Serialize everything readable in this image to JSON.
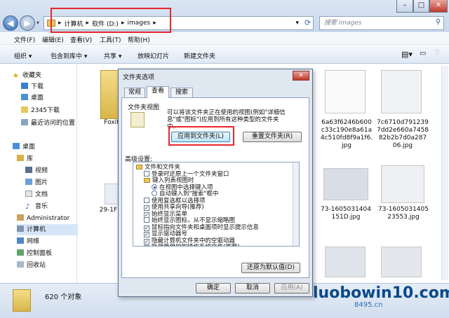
{
  "address": {
    "crumbs": [
      "计算机",
      "软件 (D:)",
      "images"
    ],
    "refresh_icon": "refresh-icon"
  },
  "search": {
    "placeholder": "搜索 images"
  },
  "menu": [
    "文件(F)",
    "编辑(E)",
    "查看(V)",
    "工具(T)",
    "帮助(H)"
  ],
  "toolbar": [
    "组织 ▾",
    "包含到库中 ▾",
    "共享 ▾",
    "放映幻灯片",
    "新建文件夹"
  ],
  "nav": {
    "favorites": {
      "label": "收藏夹",
      "items": [
        "下载",
        "桌面",
        "2345下载",
        "最近访问的位置"
      ]
    },
    "desktop": {
      "label": "桌面",
      "library": "库",
      "lib_items": [
        "视频",
        "图片",
        "文档",
        "音乐"
      ]
    },
    "others": [
      "Administrator",
      "计算机",
      "网络",
      "控制面板",
      "回收站"
    ]
  },
  "files": {
    "foxit": "Foxit",
    "file_29": "29-1FF",
    "f1": [
      "6a63f6246b600",
      "c33c190e8a61a",
      "4c510fd8f9a1f6.",
      "jpg"
    ],
    "f2": [
      "7c6710d791239",
      "7dd2e660a7458",
      "82b2b7d0a287",
      "06.jpg"
    ],
    "f3": [
      "73-1605031404",
      "151D.jpg"
    ],
    "f4": [
      "73-1605031405",
      "23553.jpg"
    ]
  },
  "status": {
    "count": "620 个对象"
  },
  "dialog": {
    "title": "文件夹选项",
    "close": "✕",
    "tabs": [
      "常规",
      "查看",
      "搜索"
    ],
    "folder_view_heading": "文件夹视图",
    "folder_view_desc": [
      "可以将该文件夹正在使用的视图(例如\"详细信",
      "息\"或\"图标\")应用到所有这种类型的文件夹",
      "中。"
    ],
    "apply_btn": "应用到文件夹(L)",
    "reset_btn": "重置文件夹(R)",
    "advanced_label": "高级设置:",
    "tree": [
      {
        "type": "folder",
        "text": "文件和文件夹",
        "indent": 0
      },
      {
        "type": "cb",
        "checked": false,
        "text": "登录时还原上一个文件夹窗口",
        "indent": 1
      },
      {
        "type": "folder",
        "text": "键入列表视图时",
        "indent": 1
      },
      {
        "type": "rb",
        "checked": true,
        "text": "在视图中选择键入项",
        "indent": 2
      },
      {
        "type": "rb",
        "checked": false,
        "text": "自动键入到\"搜索\"框中",
        "indent": 2
      },
      {
        "type": "cb",
        "checked": false,
        "text": "使用复选框以选择项",
        "indent": 1
      },
      {
        "type": "cb",
        "checked": true,
        "text": "使用共享向导(推荐)",
        "indent": 1
      },
      {
        "type": "cb",
        "checked": true,
        "text": "始终显示菜单",
        "indent": 1
      },
      {
        "type": "cb",
        "checked": false,
        "text": "始终显示图标，从不显示缩略图",
        "indent": 1
      },
      {
        "type": "cb",
        "checked": true,
        "text": "鼠标指向文件夹和桌面项时显示提示信息",
        "indent": 1
      },
      {
        "type": "cb",
        "checked": true,
        "text": "显示驱动器号",
        "indent": 1
      },
      {
        "type": "cb",
        "checked": true,
        "text": "隐藏计算机文件夹中的空驱动器",
        "indent": 1
      },
      {
        "type": "cb",
        "checked": true,
        "text": "隐藏受保护的操作系统文件(推荐)",
        "indent": 1
      }
    ],
    "restore_btn": "还原为默认值(D)",
    "ok": "确定",
    "cancel": "取消",
    "apply": "应用(A)"
  },
  "watermark": {
    "main": "luobowin10.com",
    "sub": "8495.cn"
  }
}
